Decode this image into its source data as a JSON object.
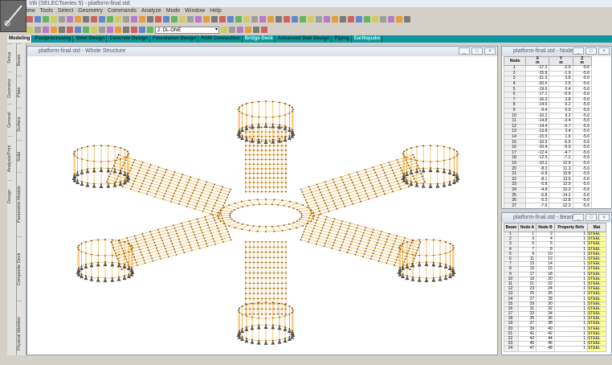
{
  "app_title": "V8i (SELECTseries 5) - platform-final.std",
  "menu": [
    "iew",
    "Tools",
    "Select",
    "Geometry",
    "Commands",
    "Analyze",
    "Mode",
    "Window",
    "Help"
  ],
  "toolbar": {
    "load_case": "2: DL-ONE"
  },
  "tabs": [
    {
      "label": "Modeling",
      "active": true
    },
    {
      "label": "Postprocessing"
    },
    {
      "label": "Steel Design"
    },
    {
      "label": "Concrete Design"
    },
    {
      "label": "Foundation Design"
    },
    {
      "label": "RAM Connection"
    },
    {
      "label": "Bridge Deck",
      "dim": true
    },
    {
      "label": "Advanced Slab Design"
    },
    {
      "label": "Piping"
    },
    {
      "label": "Earthquake",
      "dim": true
    }
  ],
  "side_tabs_outer": [
    "Setup",
    "Geometry",
    "General",
    "Analysis/Print",
    "Design"
  ],
  "side_tabs_inner": [
    "Beam",
    "Plate",
    "Surface",
    "Solid",
    "Parametric Models",
    "Composite Deck",
    "Physical Member"
  ],
  "main_window": {
    "title": "platform-final.std - Whole Structure"
  },
  "nodes_window": {
    "title": "platform-final.std - Nodes",
    "headers": [
      "Node",
      "X\nm",
      "Y\nm",
      "Z\nm"
    ],
    "rows": [
      [
        "1",
        "-17.2",
        "-2.9",
        "-5.6"
      ],
      [
        "2",
        "-15.9",
        "-1.9",
        "-5.6"
      ],
      [
        "3",
        "-21.3",
        "3.8",
        "-5.6"
      ],
      [
        "4",
        "-20.6",
        "2.5",
        "-5.6"
      ],
      [
        "5",
        "-19.6",
        "0.4",
        "-5.6"
      ],
      [
        "6",
        "-17.1",
        "-0.5",
        "-5.6"
      ],
      [
        "7",
        "-16.3",
        "3.8",
        "-5.6"
      ],
      [
        "8",
        "-14.6",
        "6.2",
        "-5.6"
      ],
      [
        "9",
        "-9.4",
        "6.9",
        "-5.6"
      ],
      [
        "10",
        "-10.2",
        "9.2",
        "-5.6"
      ],
      [
        "11",
        "-14.8",
        "-3.4",
        "-5.6"
      ],
      [
        "12",
        "-14.4",
        "-0.7",
        "-5.6"
      ],
      [
        "13",
        "-13.8",
        "3.4",
        "-5.6"
      ],
      [
        "14",
        "-15.5",
        "1.6",
        "-5.6"
      ],
      [
        "15",
        "-10.3",
        "-6.5",
        "-5.6"
      ],
      [
        "16",
        "-10.4",
        "-5.9",
        "-5.6"
      ],
      [
        "17",
        "-12.4",
        "-4.7",
        "-5.6"
      ],
      [
        "18",
        "-12.5",
        "-7.2",
        "-5.6"
      ],
      [
        "19",
        "-10.2",
        "12.9",
        "-5.6"
      ],
      [
        "20",
        "-8.3",
        "11.3",
        "-5.6"
      ],
      [
        "21",
        "-6.8",
        "15.8",
        "-5.6"
      ],
      [
        "22",
        "-8.1",
        "13.5",
        "-5.6"
      ],
      [
        "23",
        "-5.8",
        "12.9",
        "-5.6"
      ],
      [
        "24",
        "-4.8",
        "13.3",
        "-5.6"
      ],
      [
        "25",
        "-6.8",
        "-14.2",
        "-5.6"
      ],
      [
        "26",
        "-5.3",
        "-12.8",
        "-5.6"
      ],
      [
        "27",
        "-7.6",
        "-12.3",
        "-5.6"
      ]
    ]
  },
  "beams_window": {
    "title": "platform-final.std - Beams",
    "headers": [
      "Beam",
      "Node A",
      "Node B",
      "Property Refs",
      "Mat"
    ],
    "rows": [
      [
        "1",
        "1",
        "2",
        "1",
        "STEEL"
      ],
      [
        "2",
        "3",
        "4",
        "1",
        "STEEL"
      ],
      [
        "3",
        "5",
        "6",
        "1",
        "STEEL"
      ],
      [
        "4",
        "7",
        "8",
        "1",
        "STEEL"
      ],
      [
        "5",
        "9",
        "10",
        "1",
        "STEEL"
      ],
      [
        "6",
        "11",
        "12",
        "1",
        "STEEL"
      ],
      [
        "7",
        "13",
        "14",
        "1",
        "STEEL"
      ],
      [
        "8",
        "15",
        "16",
        "1",
        "STEEL"
      ],
      [
        "9",
        "17",
        "18",
        "1",
        "STEEL"
      ],
      [
        "10",
        "19",
        "20",
        "1",
        "STEEL"
      ],
      [
        "11",
        "21",
        "22",
        "1",
        "STEEL"
      ],
      [
        "12",
        "23",
        "24",
        "1",
        "STEEL"
      ],
      [
        "13",
        "25",
        "26",
        "1",
        "STEEL"
      ],
      [
        "14",
        "27",
        "28",
        "1",
        "STEEL"
      ],
      [
        "15",
        "29",
        "30",
        "1",
        "STEEL"
      ],
      [
        "16",
        "31",
        "32",
        "1",
        "STEEL"
      ],
      [
        "17",
        "33",
        "34",
        "1",
        "STEEL"
      ],
      [
        "18",
        "35",
        "36",
        "1",
        "STEEL"
      ],
      [
        "19",
        "37",
        "38",
        "1",
        "STEEL"
      ],
      [
        "20",
        "39",
        "40",
        "1",
        "STEEL"
      ],
      [
        "21",
        "41",
        "42",
        "1",
        "STEEL"
      ],
      [
        "22",
        "43",
        "44",
        "1",
        "STEEL"
      ],
      [
        "23",
        "45",
        "46",
        "1",
        "STEEL"
      ],
      [
        "24",
        "47",
        "48",
        "1",
        "STEEL"
      ]
    ]
  },
  "colors": {
    "member": "#f0a020",
    "node": "#3a2a10",
    "tab_bar": "#0e96a0",
    "material_cell": "#ffff99"
  }
}
